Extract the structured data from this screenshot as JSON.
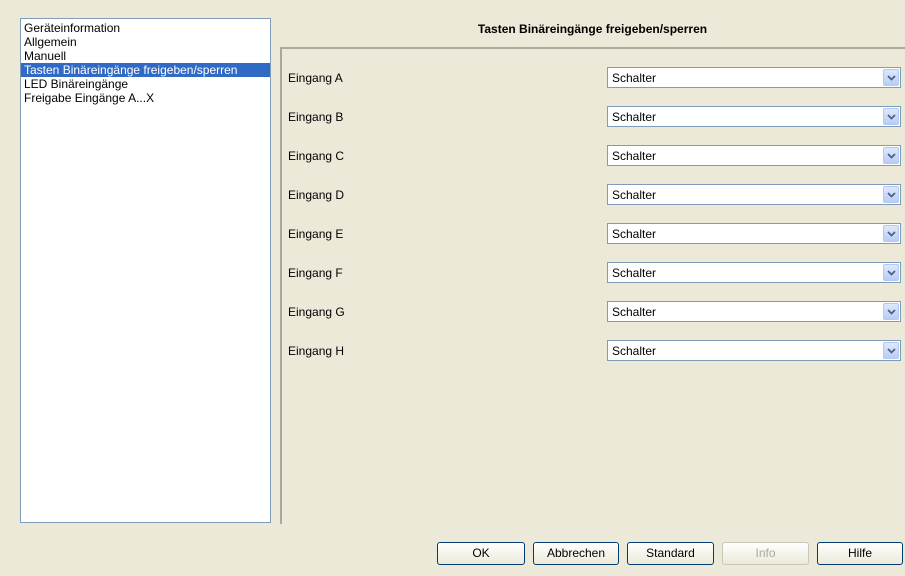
{
  "nav": {
    "items": [
      {
        "label": "Geräteinformation",
        "selected": false
      },
      {
        "label": "Allgemein",
        "selected": false
      },
      {
        "label": "Manuell",
        "selected": false
      },
      {
        "label": "Tasten Binäreingänge freigeben/sperren",
        "selected": true
      },
      {
        "label": "LED Binäreingänge",
        "selected": false
      },
      {
        "label": "Freigabe Eingänge A...X",
        "selected": false
      }
    ]
  },
  "panel": {
    "title": "Tasten Binäreingänge freigeben/sperren",
    "rows": [
      {
        "label": "Eingang A",
        "value": "Schalter"
      },
      {
        "label": "Eingang B",
        "value": "Schalter"
      },
      {
        "label": "Eingang C",
        "value": "Schalter"
      },
      {
        "label": "Eingang D",
        "value": "Schalter"
      },
      {
        "label": "Eingang E",
        "value": "Schalter"
      },
      {
        "label": "Eingang F",
        "value": "Schalter"
      },
      {
        "label": "Eingang G",
        "value": "Schalter"
      },
      {
        "label": "Eingang H",
        "value": "Schalter"
      }
    ]
  },
  "buttons": {
    "ok": "OK",
    "cancel": "Abbrechen",
    "standard": "Standard",
    "info": "Info",
    "help": "Hilfe"
  },
  "icons": {
    "dropdown": "chevron-down-icon"
  },
  "colors": {
    "selection": "#316ac5",
    "dialog_bg": "#ece9d8",
    "border": "#7f9db9"
  }
}
